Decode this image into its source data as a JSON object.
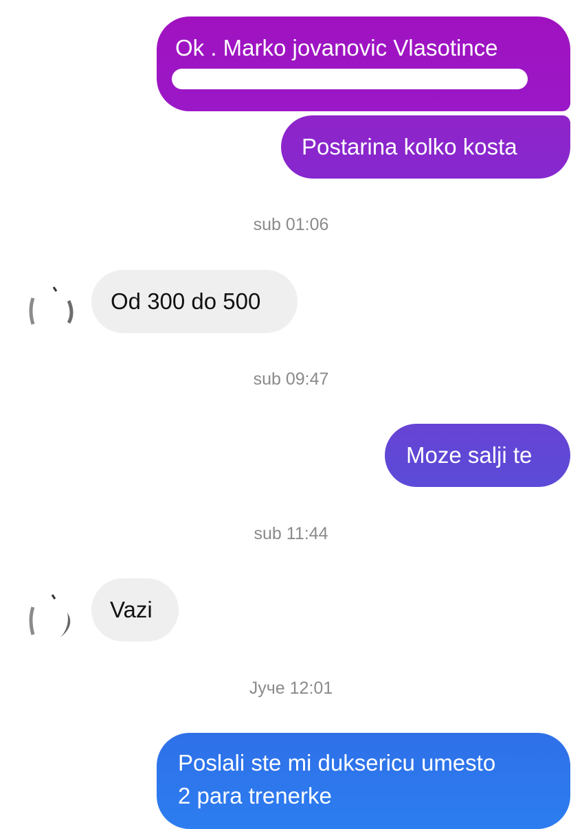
{
  "colors": {
    "bubble_top_purple": "#9a17c4",
    "bubble_mid_purple": "#6d3dd6",
    "bubble_blue": "#2f73ea",
    "incoming_bg": "#efefef",
    "timestamp_text": "#8a8a8a"
  },
  "messages": [
    {
      "type": "outgoing",
      "text": "Ok .  Marko jovanovic Vlasotince",
      "redacted_line": true
    },
    {
      "type": "outgoing",
      "text": "Postarina kolko kosta"
    },
    {
      "type": "timestamp",
      "text": "sub 01:06"
    },
    {
      "type": "incoming",
      "text": "Od 300 do 500",
      "avatar": "contact-avatar"
    },
    {
      "type": "timestamp",
      "text": "sub 09:47"
    },
    {
      "type": "outgoing",
      "text": "Moze salji te"
    },
    {
      "type": "timestamp",
      "text": "sub 11:44"
    },
    {
      "type": "incoming",
      "text": "Vazi",
      "avatar": "contact-avatar"
    },
    {
      "type": "timestamp",
      "text": "Јуче 12:01"
    },
    {
      "type": "outgoing",
      "text_lines": [
        "Poslali ste mi duksericu umesto",
        "2 para trenerke"
      ]
    }
  ]
}
